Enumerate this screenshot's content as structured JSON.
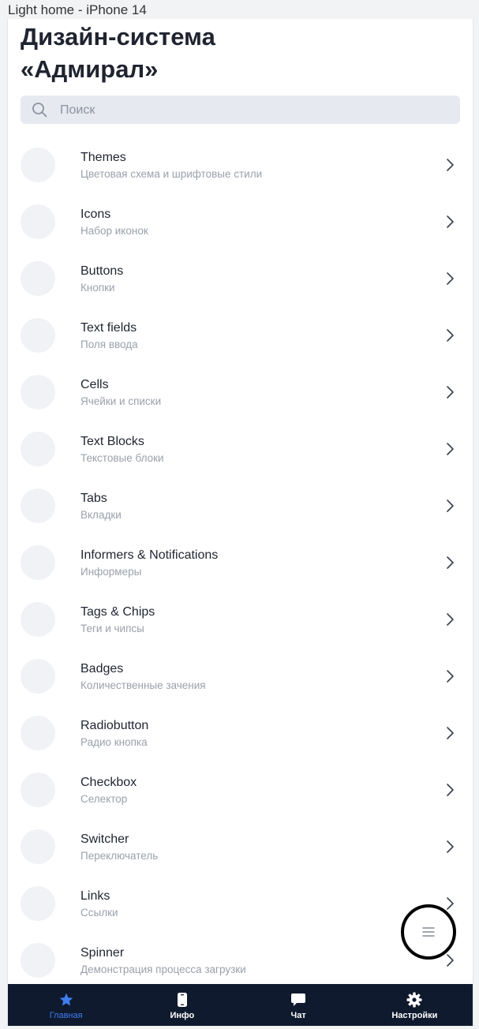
{
  "frame": {
    "label": "Light home - iPhone 14"
  },
  "header": {
    "title": "Дизайн-система\n«Адмирал»"
  },
  "search": {
    "placeholder": "Поиск",
    "icon": "search-icon"
  },
  "list": [
    {
      "title": "Themes",
      "subtitle": "Цветовая схема и шрифтовые стили"
    },
    {
      "title": "Icons",
      "subtitle": "Набор иконок"
    },
    {
      "title": "Buttons",
      "subtitle": "Кнопки"
    },
    {
      "title": "Text fields",
      "subtitle": "Поля ввода"
    },
    {
      "title": "Cells",
      "subtitle": "Ячейки и списки"
    },
    {
      "title": "Text Blocks",
      "subtitle": "Текстовые блоки"
    },
    {
      "title": "Tabs",
      "subtitle": "Вкладки"
    },
    {
      "title": "Informers & Notifications",
      "subtitle": "Информеры"
    },
    {
      "title": "Tags & Chips",
      "subtitle": "Теги и чипсы"
    },
    {
      "title": "Badges",
      "subtitle": "Количественные зачения"
    },
    {
      "title": "Radiobutton",
      "subtitle": "Радио кнопка"
    },
    {
      "title": "Checkbox",
      "subtitle": "Селектор"
    },
    {
      "title": "Switcher",
      "subtitle": "Переключатель"
    },
    {
      "title": "Links",
      "subtitle": "Ссылки"
    },
    {
      "title": "Spinner",
      "subtitle": "Демонстрация процесса загрузки"
    }
  ],
  "tabbar": {
    "tabs": [
      {
        "label": "Главная",
        "icon": "star-icon",
        "active": true
      },
      {
        "label": "Инфо",
        "icon": "phone-icon",
        "active": false
      },
      {
        "label": "Чат",
        "icon": "chat-icon",
        "active": false
      },
      {
        "label": "Настройки",
        "icon": "gear-icon",
        "active": false
      }
    ]
  },
  "fab": {
    "icon": "menu-icon"
  },
  "colors": {
    "accent": "#3d7ef0",
    "tabbar_bg": "#0f1a2e",
    "title": "#1f2430",
    "subtitle": "#9aa0ab"
  }
}
